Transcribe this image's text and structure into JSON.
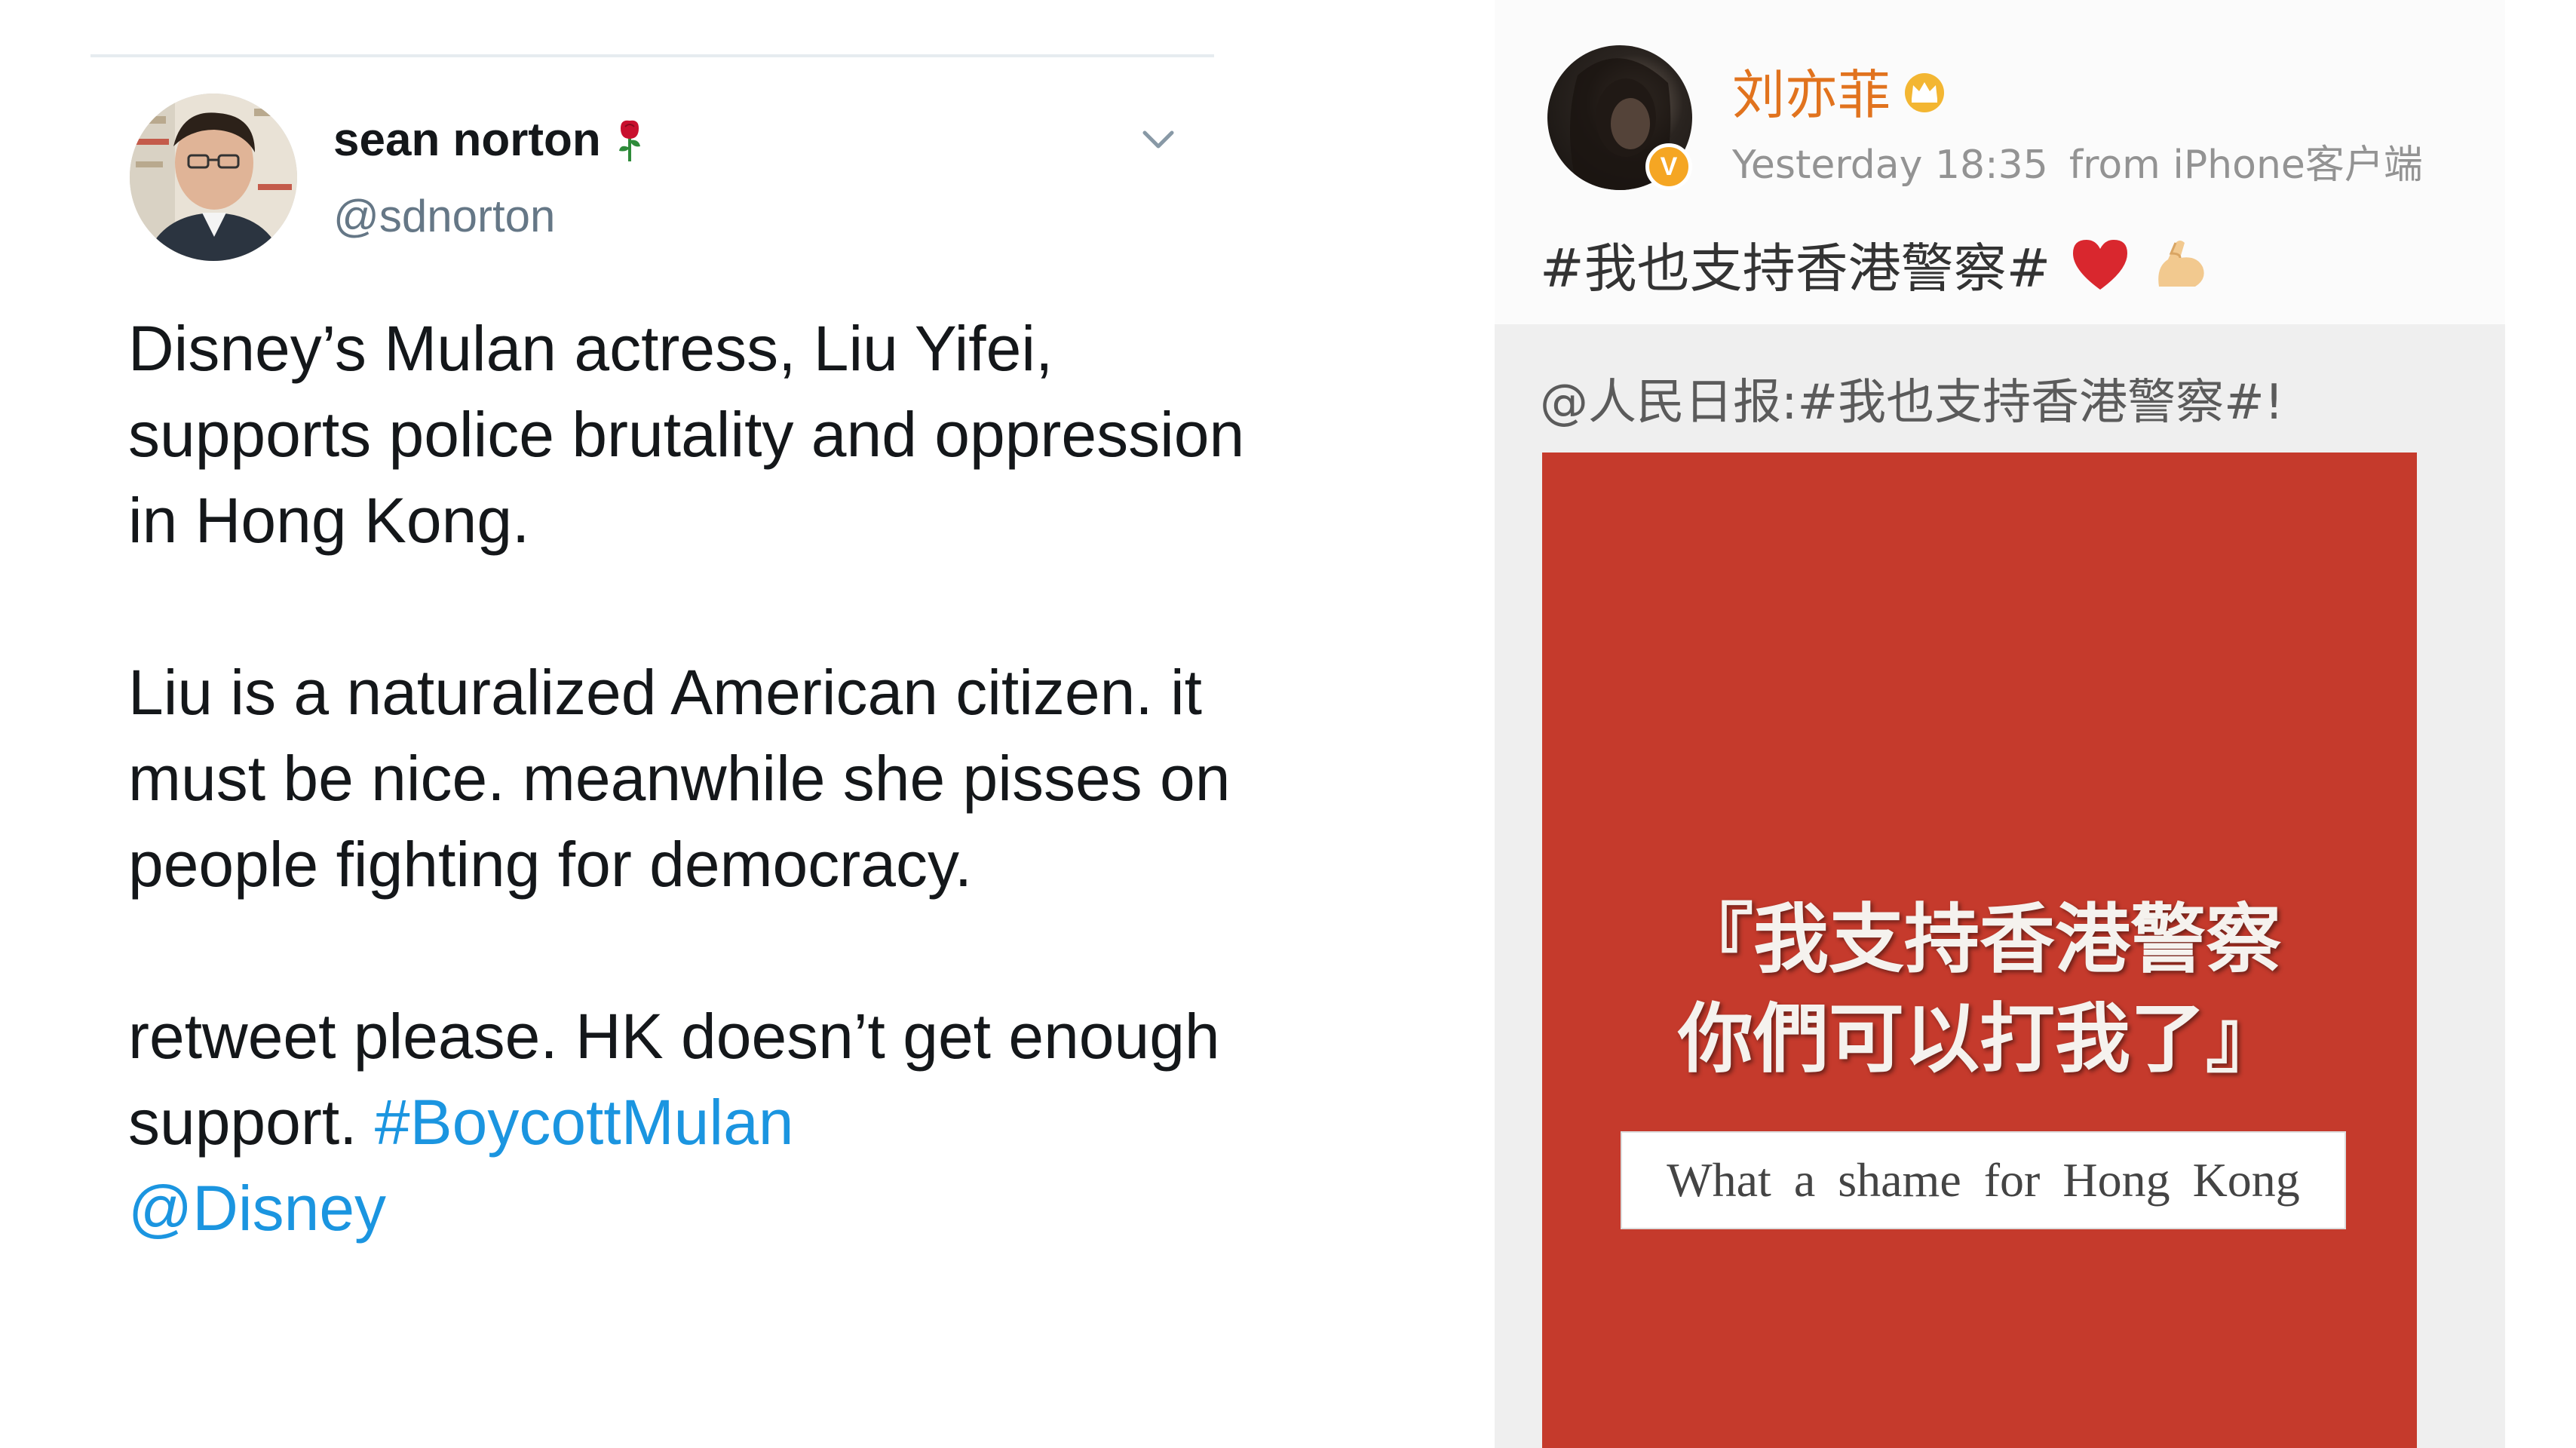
{
  "tweet": {
    "display_name": "sean norton",
    "handle": "@sdnorton",
    "paragraphs": [
      "Disney’s Mulan actress, Liu Yifei, supports police brutality and oppression in Hong Kong.",
      "Liu is a naturalized American citizen. it must be nice. meanwhile she pisses on people fighting for democracy."
    ],
    "last_paragraph_text": "retweet please. HK doesn’t get enough support. ",
    "hashtag": "#BoycottMulan",
    "mention": "@Disney",
    "emoji_after_name": "rose-icon",
    "colors": {
      "text": "#14171a",
      "secondary": "#657786",
      "link": "#1b95e0"
    }
  },
  "weibo": {
    "username": "刘亦菲",
    "timestamp": "Yesterday 18:35",
    "source": "from iPhone客户端",
    "post_text": "#我也支持香港警察#",
    "post_icons": [
      "heart-icon",
      "flexed-biceps-icon"
    ],
    "verified_badge": "V",
    "repost": {
      "text": "@人民日报:#我也支持香港警察#!",
      "image": {
        "slogan_line1": "『我支持香港警察",
        "slogan_line2": "你們可以打我了』",
        "caption": "What a shame for Hong Kong"
      }
    },
    "colors": {
      "username": "#e1731e",
      "meta": "#939393",
      "image_bg": "#c53a2c"
    }
  }
}
